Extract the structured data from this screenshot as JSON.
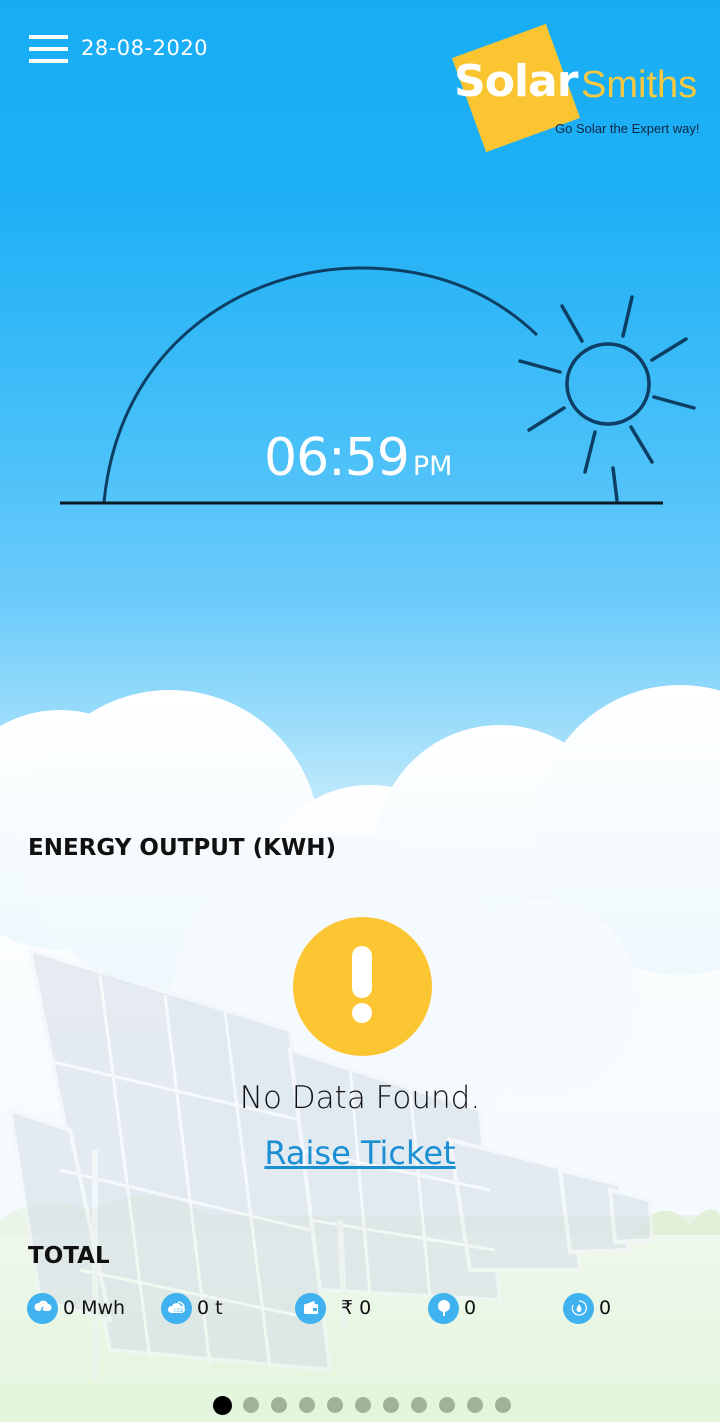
{
  "header": {
    "date": "28-08-2020",
    "menu_icon": "hamburger-menu-icon"
  },
  "logo": {
    "brand_part1": "Solar",
    "brand_part2": "Smiths",
    "tagline": "Go Solar the Expert way!",
    "colors": {
      "square": "#fbc531",
      "smiths": "#f7c840",
      "tagline": "#0f2742"
    }
  },
  "sun_tracker": {
    "time": "06:59",
    "ampm": "PM",
    "sun_icon": "sun-icon"
  },
  "energy": {
    "title": "ENERGY OUTPUT (KWH)",
    "alert_icon": "warning-exclamation-icon",
    "empty_message": "No Data Found.",
    "raise_ticket_label": "Raise Ticket"
  },
  "total": {
    "title": "TOTAL",
    "stats": [
      {
        "icon": "energy-cloud-bolt-icon",
        "value": "0 Mwh"
      },
      {
        "icon": "co2-cloud-icon",
        "value": "0 t"
      },
      {
        "icon": "wallet-icon",
        "value": "₹ 0"
      },
      {
        "icon": "tree-icon",
        "value": "0"
      },
      {
        "icon": "water-recycle-icon",
        "value": "0"
      }
    ]
  },
  "pagination": {
    "total_pages": 11,
    "active_index": 0
  },
  "colors": {
    "sky_top": "#17adf5",
    "accent_yellow": "#fcc532",
    "link_blue": "#1b8fd3",
    "stat_icon_bg": "#3fb2ef"
  }
}
